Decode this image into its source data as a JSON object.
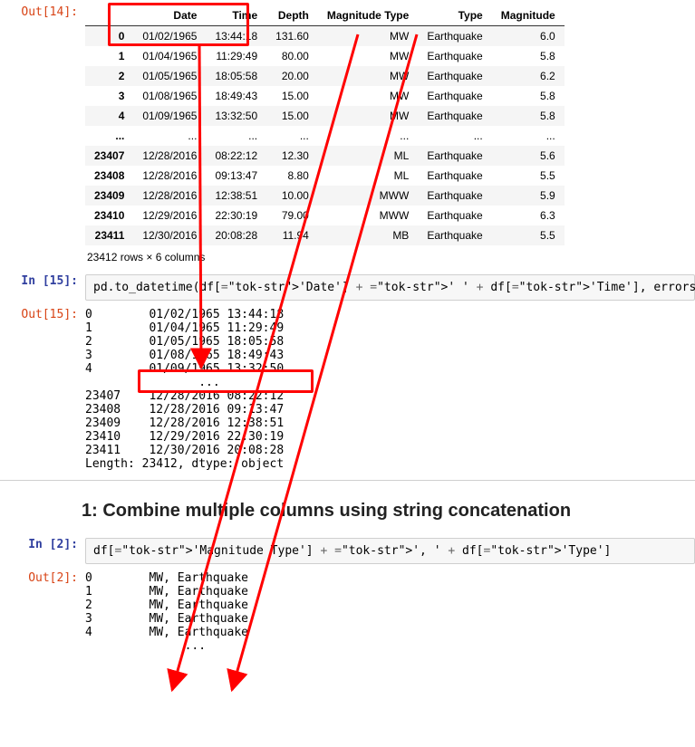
{
  "cell14": {
    "prompt": "Out[14]:",
    "columns": [
      "Date",
      "Time",
      "Depth",
      "Magnitude Type",
      "Type",
      "Magnitude"
    ],
    "rows_top": [
      {
        "idx": "0",
        "Date": "01/02/1965",
        "Time": "13:44:18",
        "Depth": "131.60",
        "MagType": "MW",
        "Type": "Earthquake",
        "Mag": "6.0"
      },
      {
        "idx": "1",
        "Date": "01/04/1965",
        "Time": "11:29:49",
        "Depth": "80.00",
        "MagType": "MW",
        "Type": "Earthquake",
        "Mag": "5.8"
      },
      {
        "idx": "2",
        "Date": "01/05/1965",
        "Time": "18:05:58",
        "Depth": "20.00",
        "MagType": "MW",
        "Type": "Earthquake",
        "Mag": "6.2"
      },
      {
        "idx": "3",
        "Date": "01/08/1965",
        "Time": "18:49:43",
        "Depth": "15.00",
        "MagType": "MW",
        "Type": "Earthquake",
        "Mag": "5.8"
      },
      {
        "idx": "4",
        "Date": "01/09/1965",
        "Time": "13:32:50",
        "Depth": "15.00",
        "MagType": "MW",
        "Type": "Earthquake",
        "Mag": "5.8"
      }
    ],
    "ellipsis_row": {
      "idx": "...",
      "Date": "...",
      "Time": "...",
      "Depth": "...",
      "MagType": "...",
      "Type": "...",
      "Mag": "..."
    },
    "rows_bottom": [
      {
        "idx": "23407",
        "Date": "12/28/2016",
        "Time": "08:22:12",
        "Depth": "12.30",
        "MagType": "ML",
        "Type": "Earthquake",
        "Mag": "5.6"
      },
      {
        "idx": "23408",
        "Date": "12/28/2016",
        "Time": "09:13:47",
        "Depth": "8.80",
        "MagType": "ML",
        "Type": "Earthquake",
        "Mag": "5.5"
      },
      {
        "idx": "23409",
        "Date": "12/28/2016",
        "Time": "12:38:51",
        "Depth": "10.00",
        "MagType": "MWW",
        "Type": "Earthquake",
        "Mag": "5.9"
      },
      {
        "idx": "23410",
        "Date": "12/29/2016",
        "Time": "22:30:19",
        "Depth": "79.00",
        "MagType": "MWW",
        "Type": "Earthquake",
        "Mag": "6.3"
      },
      {
        "idx": "23411",
        "Date": "12/30/2016",
        "Time": "20:08:28",
        "Depth": "11.94",
        "MagType": "MB",
        "Type": "Earthquake",
        "Mag": "5.5"
      }
    ],
    "caption": "23412 rows × 6 columns"
  },
  "cell15_in": {
    "prompt": "In [15]:",
    "code_plain": "pd.to_datetime(df['Date'] + ' ' + df['Time'], errors='ignore')"
  },
  "cell15_out": {
    "prompt": "Out[15]:",
    "lines": [
      "0        01/02/1965 13:44:18",
      "1        01/04/1965 11:29:49",
      "2        01/05/1965 18:05:58",
      "3        01/08/1965 18:49:43",
      "4        01/09/1965 13:32:50",
      "                ...         ",
      "23407    12/28/2016 08:22:12",
      "23408    12/28/2016 09:13:47",
      "23409    12/28/2016 12:38:51",
      "23410    12/29/2016 22:30:19",
      "23411    12/30/2016 20:08:28",
      "Length: 23412, dtype: object"
    ]
  },
  "heading1": "1: Combine multiple columns using string concatenation",
  "cell2_in": {
    "prompt": "In [2]:",
    "code_plain": "df['Magnitude Type'] + ', ' + df['Type']"
  },
  "cell2_out": {
    "prompt": "Out[2]:",
    "lines": [
      "0        MW, Earthquake",
      "1        MW, Earthquake",
      "2        MW, Earthquake",
      "3        MW, Earthquake",
      "4        MW, Earthquake",
      "              ...      "
    ]
  },
  "annotation": {
    "color": "#ff0000",
    "box1": {
      "desc": "highlight around table row 0 Date+Time header/cell"
    },
    "box2": {
      "desc": "highlight around first line of Out[15] series"
    },
    "arrows": [
      {
        "from": "table Date/Time header",
        "to": "Out[15] first value"
      },
      {
        "from": "table Magnitude Type column",
        "to": "Out[2] MW"
      },
      {
        "from": "table Type column",
        "to": "Out[2] Earthquake"
      }
    ]
  }
}
